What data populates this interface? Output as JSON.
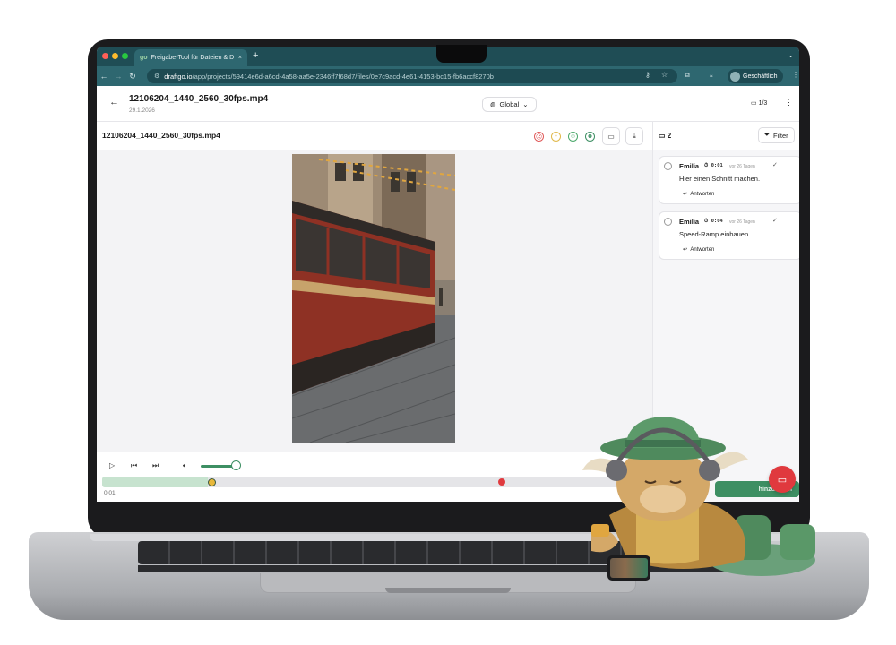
{
  "browser": {
    "tab_title": "Freigabe-Tool für Dateien & D",
    "tab_favicon": "go",
    "url_host": "draftgo.io",
    "url_path": "/app/projects/59414e6d-a6cd-4a58-aa5e-2346ff7f68d7/files/0e7c9acd-4e61-4153-bc15-fb6accf8270b",
    "profile_label": "Geschäftlich",
    "colors": {
      "tabbar": "#1f4d55",
      "addressbar": "#2e6770"
    }
  },
  "header": {
    "file_title": "12106204_1440_2560_30fps.mp4",
    "date": "29.1.2026",
    "scope_label": "Global",
    "pager": "1/3"
  },
  "toolbar": {
    "file_name": "12106204_1440_2560_30fps.mp4",
    "ratings": [
      {
        "icon": "sad-face-icon",
        "color": "#e05a5a"
      },
      {
        "icon": "neutral-face-icon",
        "color": "#e0b84a"
      },
      {
        "icon": "smile-face-icon",
        "color": "#4aa86a"
      },
      {
        "icon": "happy-face-icon",
        "color": "#3d8f63"
      }
    ]
  },
  "player": {
    "timecode": "0:01",
    "add_comment_label": "hinzufügen",
    "progress_fraction": 0.19,
    "volume_fraction": 0.9,
    "accent_color": "#3d8f63"
  },
  "comments": {
    "count": "2",
    "filter_label": "Filter",
    "items": [
      {
        "author": "Emilia",
        "time": "0:01",
        "ago": "vor 26 Tagen",
        "text": "Hier einen Schnitt machen.",
        "reply_label": "Antworten"
      },
      {
        "author": "Emilia",
        "time": "0:04",
        "ago": "vor 26 Tagen",
        "text": "Speed-Ramp einbauen.",
        "reply_label": "Antworten"
      }
    ]
  },
  "fab_color": "#e0393e"
}
